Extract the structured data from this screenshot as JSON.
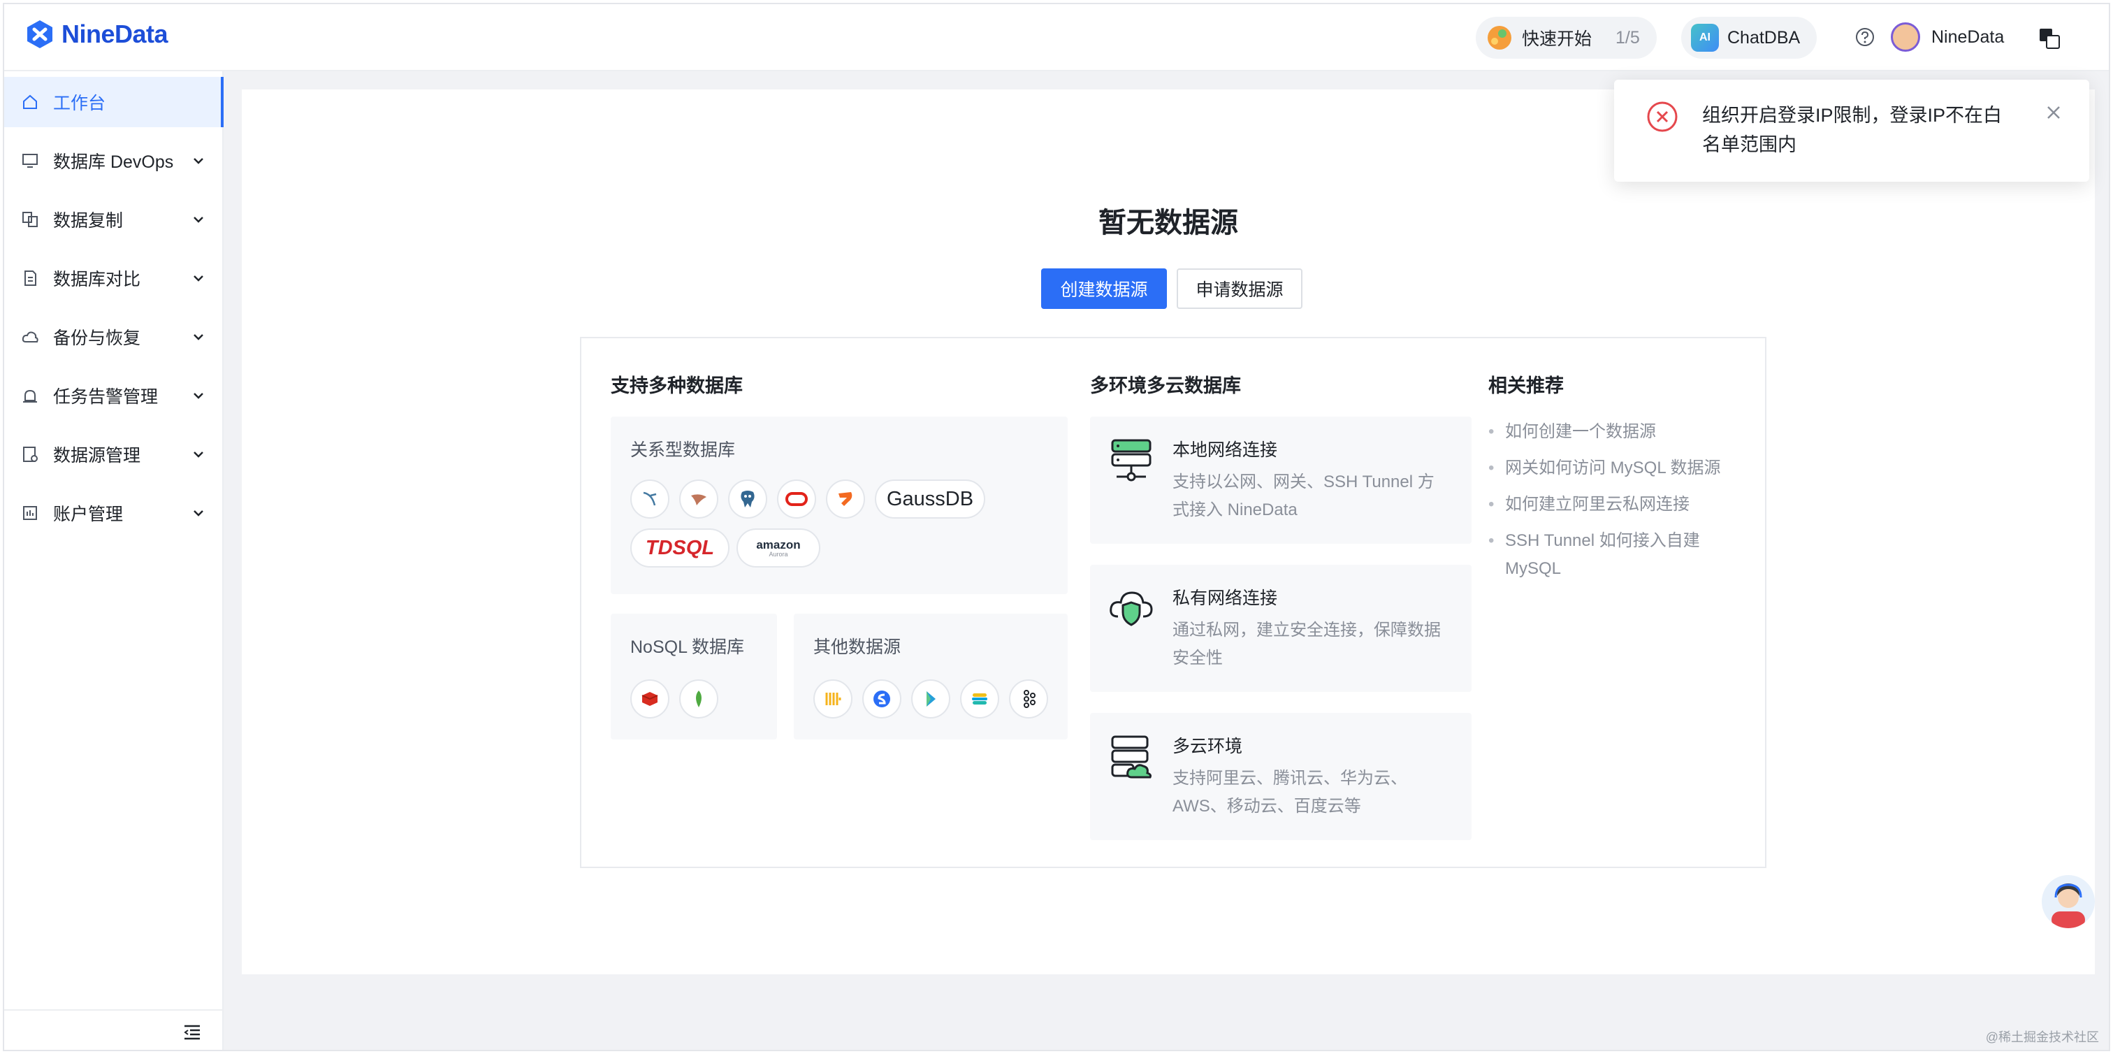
{
  "header": {
    "logo": "NineData",
    "quickstart": {
      "label": "快速开始",
      "count": "1/5"
    },
    "chatdba": {
      "label": "ChatDBA",
      "badge": "AI"
    },
    "user": "NineData"
  },
  "sidebar": {
    "items": [
      {
        "label": "工作台",
        "icon": "home-icon",
        "active": true
      },
      {
        "label": "数据库 DevOps",
        "icon": "monitor-icon"
      },
      {
        "label": "数据复制",
        "icon": "copy-icon"
      },
      {
        "label": "数据库对比",
        "icon": "compare-icon"
      },
      {
        "label": "备份与恢复",
        "icon": "cloud-backup-icon"
      },
      {
        "label": "任务告警管理",
        "icon": "alarm-icon"
      },
      {
        "label": "数据源管理",
        "icon": "datasource-icon"
      },
      {
        "label": "账户管理",
        "icon": "account-icon"
      }
    ]
  },
  "main": {
    "title": "暂无数据源",
    "create_button": "创建数据源",
    "apply_button": "申请数据源",
    "support": {
      "title": "支持多种数据库",
      "relational_label": "关系型数据库",
      "gaussdb": "GaussDB",
      "tdsql": "TDSQL",
      "amazon": "amazon",
      "amazon_sub": "Aurora",
      "nosql_label": "NoSQL 数据库",
      "other_label": "其他数据源"
    },
    "multi_env": {
      "title": "多环境多云数据库",
      "features": [
        {
          "title": "本地网络连接",
          "desc_lines": [
            "支持以公网、网关、SSH Tunnel 方",
            "式接入 NineData"
          ]
        },
        {
          "title": "私有网络连接",
          "desc_lines": [
            "通过私网，建立安全连接，保障数据",
            "安全性"
          ]
        },
        {
          "title": "多云环境",
          "desc_lines": [
            "支持阿里云、腾讯云、华为云、",
            "AWS、移动云、百度云等"
          ]
        }
      ]
    },
    "recommend": {
      "title": "相关推荐",
      "items": [
        {
          "lines": [
            "如何创建一个数据源"
          ]
        },
        {
          "lines": [
            "网关如何访问 MySQL 数据源"
          ]
        },
        {
          "lines": [
            "如何建立阿里云私网连接"
          ]
        },
        {
          "lines": [
            "SSH Tunnel 如何接入自建",
            "MySQL"
          ]
        }
      ]
    }
  },
  "toast": {
    "lines": [
      "组织开启登录IP限制，登录IP不在白",
      "名单范围内"
    ]
  },
  "watermark": "@稀土掘金技术社区",
  "colors": {
    "accent": "#2b6ef6",
    "error": "#e5484d"
  }
}
